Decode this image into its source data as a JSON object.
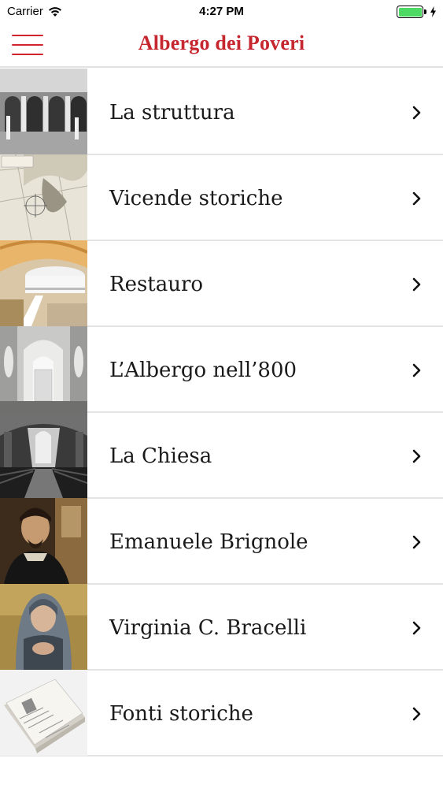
{
  "status_bar": {
    "carrier": "Carrier",
    "time": "4:27 PM",
    "battery_color": "#4cd964"
  },
  "nav": {
    "title": "Albergo dei Poveri",
    "menu_icon": "hamburger-icon",
    "accent_color": "#c6262e"
  },
  "menu_items": [
    {
      "label": "La struttura",
      "thumb": "arcade-hall-photo"
    },
    {
      "label": "Vicende storiche",
      "thumb": "historic-map"
    },
    {
      "label": "Restauro",
      "thumb": "restored-interior-photo"
    },
    {
      "label": "L’Albergo nell’800",
      "thumb": "statue-corridor-photo"
    },
    {
      "label": "La Chiesa",
      "thumb": "church-nave-photo"
    },
    {
      "label": "Emanuele Brignole",
      "thumb": "brignole-portrait"
    },
    {
      "label": "Virginia C. Bracelli",
      "thumb": "bracelli-portrait"
    },
    {
      "label": "Fonti storiche",
      "thumb": "historic-documents"
    }
  ]
}
